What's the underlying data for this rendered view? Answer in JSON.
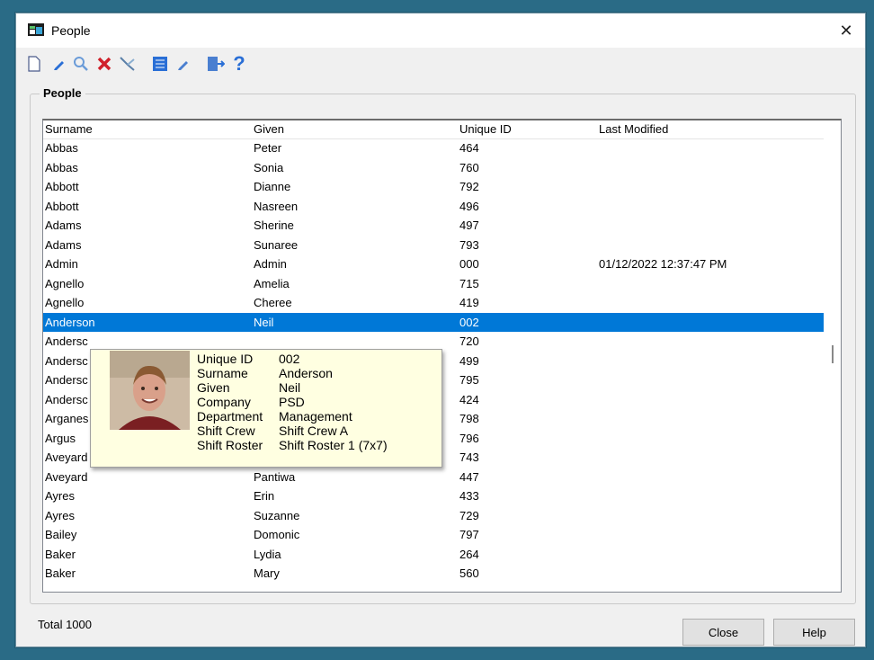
{
  "window": {
    "title": "People",
    "close_glyph": "✕"
  },
  "toolbar": {
    "buttons": [
      {
        "icon": "new-document-icon"
      },
      {
        "icon": "edit-pencil-icon"
      },
      {
        "icon": "search-icon"
      },
      {
        "icon": "delete-x-icon"
      },
      {
        "icon": "filter-wand-icon"
      },
      {
        "icon": "list-details-icon"
      },
      {
        "icon": "eraser-icon"
      },
      {
        "icon": "exit-door-icon"
      },
      {
        "icon": "help-question-icon",
        "glyph": "?"
      }
    ]
  },
  "group": {
    "label": "People"
  },
  "table": {
    "columns": [
      "Surname",
      "Given",
      "Unique ID",
      "Last Modified"
    ],
    "rows": [
      {
        "surname": "Abbas",
        "given": "Peter",
        "uid": "464",
        "modified": ""
      },
      {
        "surname": "Abbas",
        "given": "Sonia",
        "uid": "760",
        "modified": ""
      },
      {
        "surname": "Abbott",
        "given": "Dianne",
        "uid": "792",
        "modified": ""
      },
      {
        "surname": "Abbott",
        "given": "Nasreen",
        "uid": "496",
        "modified": ""
      },
      {
        "surname": "Adams",
        "given": "Sherine",
        "uid": "497",
        "modified": ""
      },
      {
        "surname": "Adams",
        "given": "Sunaree",
        "uid": "793",
        "modified": ""
      },
      {
        "surname": "Admin",
        "given": "Admin",
        "uid": "000",
        "modified": "01/12/2022 12:37:47 PM"
      },
      {
        "surname": "Agnello",
        "given": "Amelia",
        "uid": "715",
        "modified": ""
      },
      {
        "surname": "Agnello",
        "given": "Cheree",
        "uid": "419",
        "modified": ""
      },
      {
        "surname": "Anderson",
        "given": "Neil",
        "uid": "002",
        "modified": "",
        "selected": true
      },
      {
        "surname": "Andersc",
        "given": "",
        "uid": "720",
        "modified": ""
      },
      {
        "surname": "Andersc",
        "given": "",
        "uid": "499",
        "modified": ""
      },
      {
        "surname": "Andersc",
        "given": "",
        "uid": "795",
        "modified": ""
      },
      {
        "surname": "Andersc",
        "given": "",
        "uid": "424",
        "modified": ""
      },
      {
        "surname": "Arganes",
        "given": "",
        "uid": "798",
        "modified": ""
      },
      {
        "surname": "Argus",
        "given": "",
        "uid": "796",
        "modified": ""
      },
      {
        "surname": "Aveyard",
        "given": "Louise",
        "uid": "743",
        "modified": ""
      },
      {
        "surname": "Aveyard",
        "given": "Pantiwa",
        "uid": "447",
        "modified": ""
      },
      {
        "surname": "Ayres",
        "given": "Erin",
        "uid": "433",
        "modified": ""
      },
      {
        "surname": "Ayres",
        "given": "Suzanne",
        "uid": "729",
        "modified": ""
      },
      {
        "surname": "Bailey",
        "given": "Domonic",
        "uid": "797",
        "modified": ""
      },
      {
        "surname": "Baker",
        "given": "Lydia",
        "uid": "264",
        "modified": ""
      },
      {
        "surname": "Baker",
        "given": "Mary",
        "uid": "560",
        "modified": ""
      }
    ]
  },
  "tooltip": {
    "fields": [
      {
        "label": "Unique ID",
        "value": "002"
      },
      {
        "label": "Surname",
        "value": "Anderson"
      },
      {
        "label": "Given",
        "value": "Neil"
      },
      {
        "label": "Company",
        "value": "PSD"
      },
      {
        "label": "Department",
        "value": "Management"
      },
      {
        "label": "Shift Crew",
        "value": "Shift Crew A"
      },
      {
        "label": "Shift Roster",
        "value": "Shift Roster 1 (7x7)"
      }
    ]
  },
  "footer": {
    "total": "Total 1000",
    "close_label": "Close",
    "help_label": "Help"
  },
  "colors": {
    "selection": "#0078d7",
    "tooltip_bg": "#ffffe1",
    "delete_red": "#d0202a",
    "toolbar_blue": "#2a6fd6"
  }
}
